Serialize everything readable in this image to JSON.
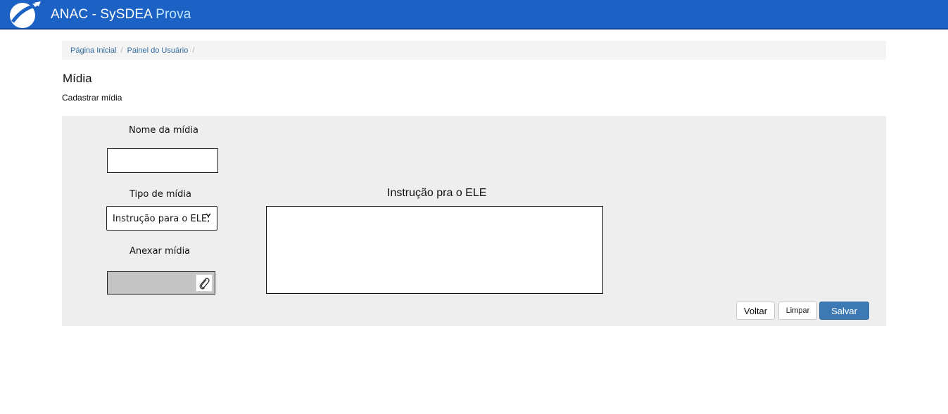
{
  "header": {
    "app_name": "ANAC - SySDEA",
    "app_mode": "Prova",
    "logo_icon": "airplane-globe-logo",
    "bg_color": "#1b62c4"
  },
  "breadcrumb": {
    "items": [
      {
        "label": "Página Inicial"
      },
      {
        "label": "Painel do Usuário"
      }
    ],
    "separator": "/"
  },
  "page": {
    "title": "Mídia",
    "subtitle": "Cadastrar mídia"
  },
  "form": {
    "nome_label": "Nome da mídia",
    "nome_value": "",
    "tipo_label": "Tipo de mídia",
    "tipo_selected": "Instrução para o ELE;",
    "tipo_chevron_icon": "chevron-down-icon",
    "anexar_label": "Anexar mídia",
    "attach_icon": "paperclip-icon",
    "preview_title": "Instrução pra o ELE"
  },
  "actions": {
    "voltar_label": "Voltar",
    "limpar_label": "Limpar",
    "salvar_label": "Salvar",
    "salvar_color": "#3d7ab5"
  }
}
